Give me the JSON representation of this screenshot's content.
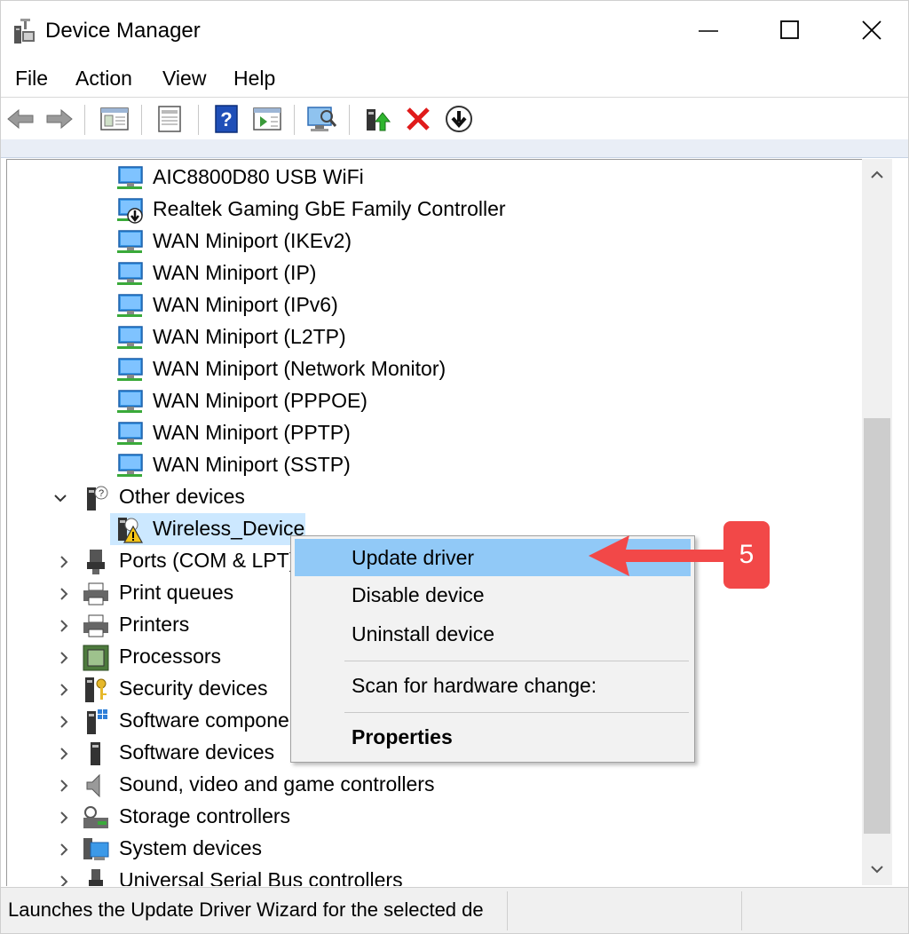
{
  "window": {
    "title": "Device Manager",
    "controls": [
      "minimize",
      "maximize",
      "close"
    ]
  },
  "menubar": {
    "items": [
      "File",
      "Action",
      "View",
      "Help"
    ]
  },
  "toolbar": {
    "buttons": [
      "back-icon",
      "forward-icon",
      "show-hide-console-tree-icon",
      "properties-icon",
      "help-icon",
      "action-pane-icon",
      "scan-hardware-icon",
      "update-driver-icon",
      "uninstall-device-icon",
      "enable-device-icon"
    ]
  },
  "tree": {
    "network_adapters": [
      {
        "label": "AIC8800D80 USB WiFi",
        "icon": "network-adapter-icon"
      },
      {
        "label": "Realtek Gaming GbE Family Controller",
        "icon": "network-adapter-download-icon"
      },
      {
        "label": "WAN Miniport (IKEv2)",
        "icon": "network-adapter-icon"
      },
      {
        "label": "WAN Miniport (IP)",
        "icon": "network-adapter-icon"
      },
      {
        "label": "WAN Miniport (IPv6)",
        "icon": "network-adapter-icon"
      },
      {
        "label": "WAN Miniport (L2TP)",
        "icon": "network-adapter-icon"
      },
      {
        "label": "WAN Miniport (Network Monitor)",
        "icon": "network-adapter-icon"
      },
      {
        "label": "WAN Miniport (PPPOE)",
        "icon": "network-adapter-icon"
      },
      {
        "label": "WAN Miniport (PPTP)",
        "icon": "network-adapter-icon"
      },
      {
        "label": "WAN Miniport (SSTP)",
        "icon": "network-adapter-icon"
      }
    ],
    "other_devices": {
      "label": "Other devices",
      "expanded": true
    },
    "selected_device": {
      "label": "Wireless_Device",
      "icon": "warning-device-icon"
    },
    "categories": [
      {
        "label": "Ports (COM & LPT)",
        "icon": "port-icon"
      },
      {
        "label": "Print queues",
        "icon": "printer-icon"
      },
      {
        "label": "Printers",
        "icon": "printer-icon"
      },
      {
        "label": "Processors",
        "icon": "processor-icon"
      },
      {
        "label": "Security devices",
        "icon": "security-key-icon"
      },
      {
        "label": "Software compone",
        "icon": "software-component-icon"
      },
      {
        "label": "Software devices",
        "icon": "software-device-icon"
      },
      {
        "label": "Sound, video and game controllers",
        "icon": "speaker-icon"
      },
      {
        "label": "Storage controllers",
        "icon": "storage-icon"
      },
      {
        "label": "System devices",
        "icon": "system-device-icon"
      },
      {
        "label": "Universal Serial Bus controllers",
        "icon": "usb-icon"
      }
    ]
  },
  "context_menu": {
    "items": [
      {
        "label": "Update driver",
        "highlighted": true
      },
      {
        "label": "Disable device"
      },
      {
        "label": "Uninstall device"
      },
      {
        "label": "Scan for hardware change:"
      },
      {
        "label": "Properties",
        "bold": true
      }
    ]
  },
  "annotation": {
    "step": "5",
    "color": "#f24848"
  },
  "statusbar": {
    "text": "Launches the Update Driver Wizard for the selected de"
  },
  "colors": {
    "selection": "#cce8ff",
    "menu_highlight": "#91c9f7",
    "annotation": "#f24848"
  }
}
